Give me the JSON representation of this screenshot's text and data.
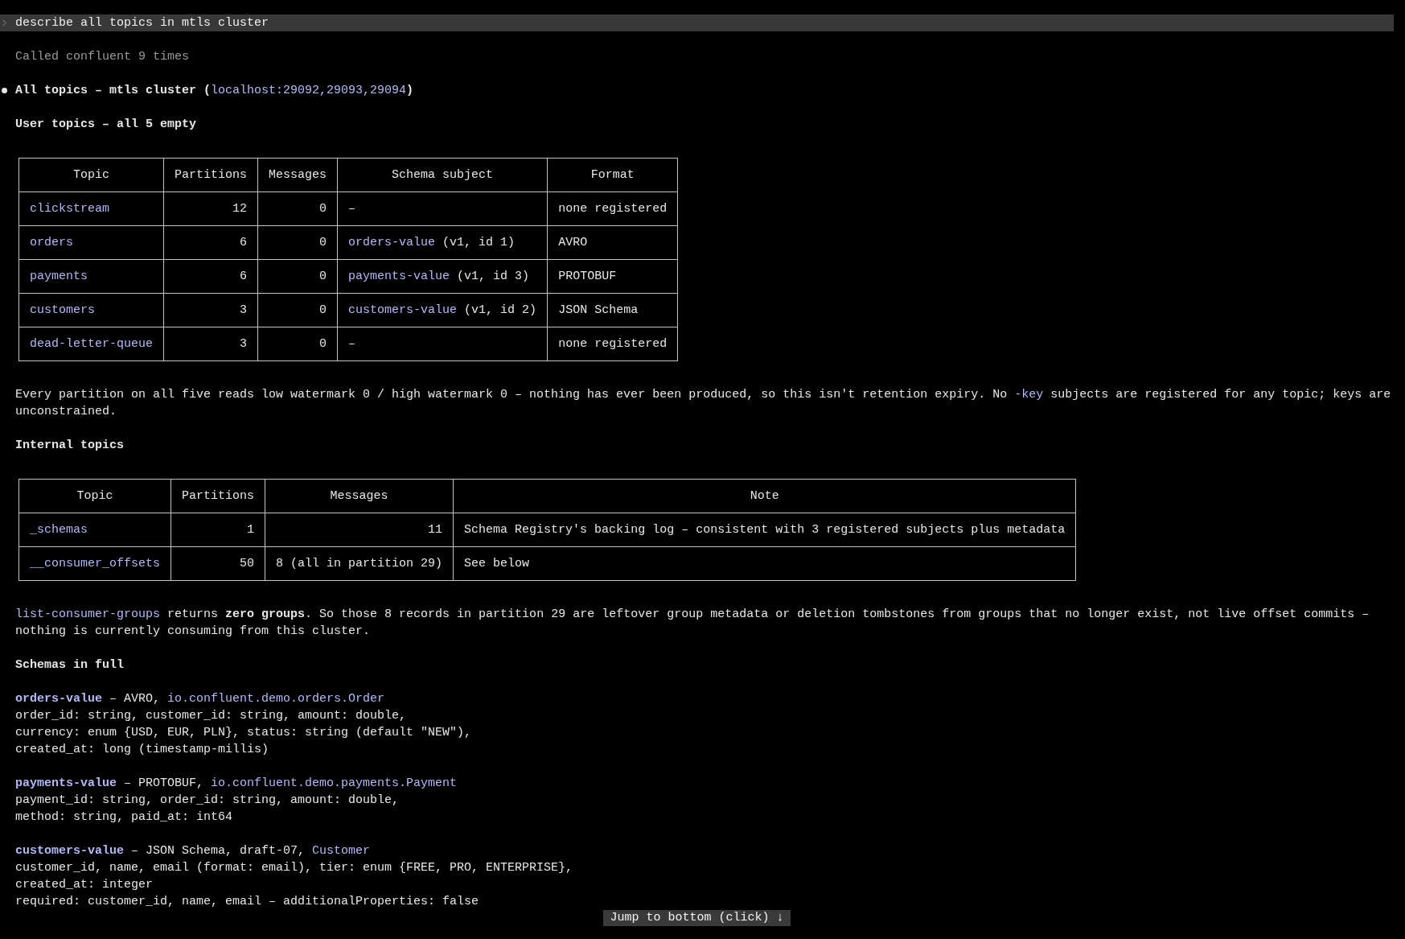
{
  "prompt": {
    "text": "describe all topics in mtls cluster"
  },
  "tool_summary": "Called confluent 9 times",
  "heading": [
    {
      "kind": "text",
      "text": "All topics – mtls cluster ("
    },
    {
      "kind": "code",
      "text": "localhost:29092,29093,29094"
    },
    {
      "kind": "text",
      "text": ")"
    }
  ],
  "blocks": [
    {
      "kind": "subheading",
      "text": "User topics – all 5 empty"
    },
    {
      "kind": "table",
      "columns": [
        {
          "label": "Topic",
          "kind": "text"
        },
        {
          "label": "Partitions",
          "kind": "number"
        },
        {
          "label": "Messages",
          "kind": "number"
        },
        {
          "label": "Schema subject",
          "kind": "text"
        },
        {
          "label": "Format",
          "kind": "text"
        }
      ],
      "rows": [
        [
          [
            {
              "kind": "code",
              "text": "clickstream"
            }
          ],
          "12",
          "0",
          "–",
          "none registered"
        ],
        [
          [
            {
              "kind": "code",
              "text": "orders"
            }
          ],
          "6",
          "0",
          [
            {
              "kind": "code",
              "text": "orders-value"
            },
            {
              "kind": "text",
              "text": " (v1, id 1)"
            }
          ],
          "AVRO"
        ],
        [
          [
            {
              "kind": "code",
              "text": "payments"
            }
          ],
          "6",
          "0",
          [
            {
              "kind": "code",
              "text": "payments-value"
            },
            {
              "kind": "text",
              "text": " (v1, id 3)"
            }
          ],
          "PROTOBUF"
        ],
        [
          [
            {
              "kind": "code",
              "text": "customers"
            }
          ],
          "3",
          "0",
          [
            {
              "kind": "code",
              "text": "customers-value"
            },
            {
              "kind": "text",
              "text": " (v1, id 2)"
            }
          ],
          "JSON Schema"
        ],
        [
          [
            {
              "kind": "code",
              "text": "dead-letter-queue"
            }
          ],
          "3",
          "0",
          "–",
          "none registered"
        ]
      ]
    },
    {
      "kind": "paragraph",
      "text": [
        {
          "kind": "text",
          "text": "Every partition on all five reads low watermark 0 / high watermark 0 – nothing has ever been produced, so this isn't retention expiry. No "
        },
        {
          "kind": "code",
          "text": "-key"
        },
        {
          "kind": "text",
          "text": " subjects are registered for any topic; keys are unconstrained."
        }
      ]
    },
    {
      "kind": "subheading",
      "text": "Internal topics"
    },
    {
      "kind": "table",
      "columns": [
        {
          "label": "Topic",
          "kind": "text"
        },
        {
          "label": "Partitions",
          "kind": "number"
        },
        {
          "label": "Messages",
          "kind": "number"
        },
        {
          "label": "Note",
          "kind": "text"
        }
      ],
      "rows": [
        [
          [
            {
              "kind": "code",
              "text": "_schemas"
            }
          ],
          "1",
          "11",
          "Schema Registry's backing log – consistent with 3 registered subjects plus metadata"
        ],
        [
          [
            {
              "kind": "code",
              "text": "__consumer_offsets"
            }
          ],
          "50",
          "8 (all in partition 29)",
          "See below"
        ]
      ]
    },
    {
      "kind": "paragraph",
      "text": [
        {
          "kind": "code",
          "text": "list-consumer-groups"
        },
        {
          "kind": "text",
          "text": " returns **zero groups**. So those 8 records in partition 29 are leftover group metadata or deletion tombstones from groups that no longer exist, not live offset commits – nothing is currently consuming from this cluster."
        }
      ]
    },
    {
      "kind": "subheading",
      "text": "Schemas in full"
    },
    {
      "kind": "schema",
      "title": [
        {
          "kind": "code",
          "text": "**orders-value**"
        },
        {
          "kind": "text",
          "text": " – AVRO, "
        },
        {
          "kind": "code",
          "text": "io.confluent.demo.orders.Order"
        }
      ],
      "lines": [
        "order_id: string, customer_id: string, amount: double,",
        "currency: enum {USD, EUR, PLN}, status: string (default \"NEW\"),",
        "created_at: long (timestamp-millis)"
      ]
    },
    {
      "kind": "schema",
      "title": [
        {
          "kind": "code",
          "text": "**payments-value**"
        },
        {
          "kind": "text",
          "text": " – PROTOBUF, "
        },
        {
          "kind": "code",
          "text": "io.confluent.demo.payments.Payment"
        }
      ],
      "lines": [
        "payment_id: string, order_id: string, amount: double,",
        "method: string, paid_at: int64"
      ]
    },
    {
      "kind": "schema",
      "title": [
        {
          "kind": "code",
          "text": "**customers-value**"
        },
        {
          "kind": "text",
          "text": " – JSON Schema, draft-07, "
        },
        {
          "kind": "code",
          "text": "Customer"
        }
      ],
      "lines": [
        "customer_id, name, email (format: email), tier: enum {FREE, PRO, ENTERPRISE},",
        "created_at: integer",
        "required: customer_id, name, email – additionalProperties: false"
      ]
    }
  ],
  "jump_button": {
    "label": "Jump to bottom (click) ↓"
  }
}
